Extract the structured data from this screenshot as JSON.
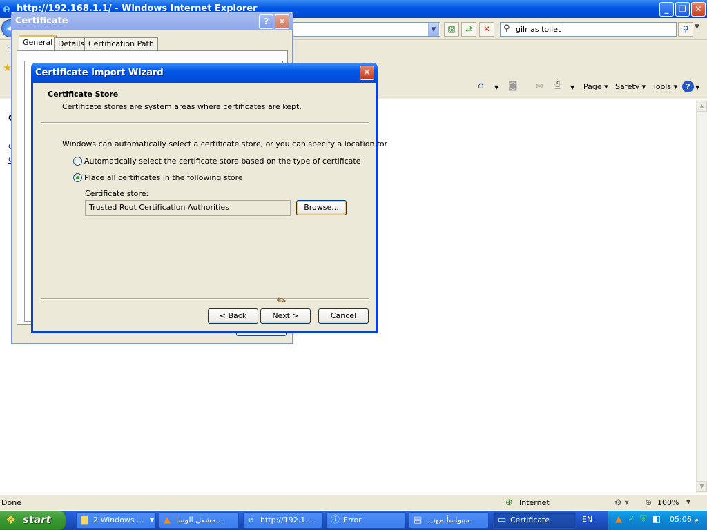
{
  "ie": {
    "title": "http://192.168.1.1/ - Windows Internet Explorer",
    "search_value": "gilr as toilet",
    "menu_f": "F",
    "cmd": {
      "page": "Page ▾",
      "safety": "Safety ▾",
      "tools": "Tools ▾"
    },
    "page_char": "C",
    "page_link_1": "C",
    "page_link_2": "C",
    "status": "Done",
    "zone": "Internet",
    "zoom": "100%"
  },
  "cert_dialog": {
    "title": "Certificate",
    "tabs": [
      "General",
      "Details",
      "Certification Path"
    ]
  },
  "wizard": {
    "title": "Certificate Import Wizard",
    "heading": "Certificate Store",
    "subheading": "Certificate stores are system areas where certificates are kept.",
    "intro": "Windows can automatically select a certificate store, or you can specify a location for",
    "options": [
      {
        "label": "Automatically select the certificate store based on the type of certificate",
        "selected": false
      },
      {
        "label": "Place all certificates in the following store",
        "selected": true
      }
    ],
    "store_label": "Certificate store:",
    "store_value": "Trusted Root Certification Authorities",
    "browse": "Browse...",
    "back": "< Back",
    "next": "Next >",
    "cancel": "Cancel"
  },
  "taskbar": {
    "start": "start",
    "tasks": [
      {
        "label": "2 Windows ...",
        "icon": "folder-icon"
      },
      {
        "label": "مشعل الوسا...",
        "icon": "vlc-icon"
      },
      {
        "label": "http://192.1...",
        "icon": "ie-icon"
      },
      {
        "label": "Error",
        "icon": "info-icon"
      },
      {
        "label": "...ﻪﻴﺑﻮﻠﺳأ ﻢﻬﺘ",
        "icon": "document-icon"
      },
      {
        "label": "Certificate",
        "icon": "certificate-icon"
      }
    ],
    "language": "EN",
    "clock": "05:06 م"
  }
}
